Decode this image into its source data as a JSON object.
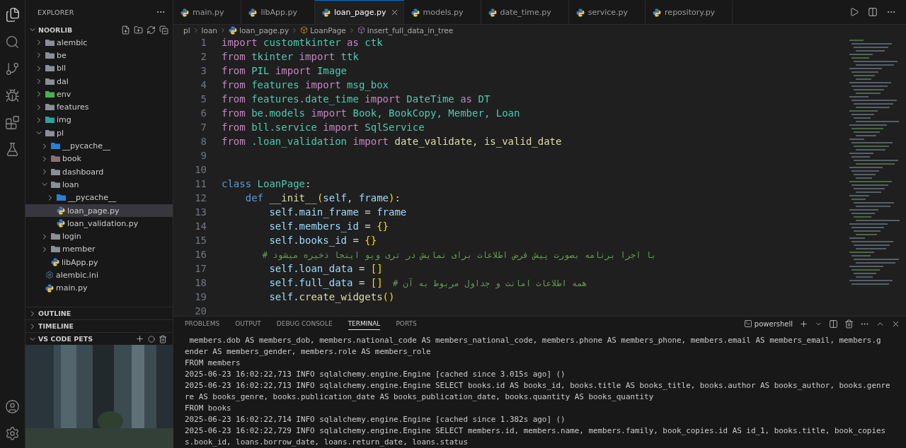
{
  "explorer": {
    "title": "EXPLORER",
    "project": {
      "name": "NOORLIB",
      "expanded": true
    },
    "tree": [
      {
        "label": "alembic",
        "kind": "folder",
        "expanded": false,
        "selected": false
      },
      {
        "label": "be",
        "kind": "folder",
        "expanded": false,
        "selected": false
      },
      {
        "label": "bll",
        "kind": "folder",
        "expanded": false,
        "selected": false
      },
      {
        "label": "dal",
        "kind": "folder",
        "expanded": false,
        "selected": false
      },
      {
        "label": "env",
        "kind": "env-folder",
        "expanded": false,
        "selected": false
      },
      {
        "label": "features",
        "kind": "folder",
        "expanded": false,
        "selected": false
      },
      {
        "label": "img",
        "kind": "image-folder",
        "expanded": false,
        "selected": false
      },
      {
        "label": "pl",
        "kind": "folder",
        "expanded": true,
        "selected": false,
        "children": [
          {
            "label": "__pycache__",
            "kind": "cache-folder",
            "expanded": false,
            "selected": false
          },
          {
            "label": "book",
            "kind": "book-folder",
            "expanded": false,
            "selected": false
          },
          {
            "label": "dashboard",
            "kind": "folder",
            "expanded": false,
            "selected": false
          },
          {
            "label": "loan",
            "kind": "folder",
            "expanded": true,
            "selected": false,
            "children": [
              {
                "label": "__pycache__",
                "kind": "cache-folder",
                "expanded": false,
                "selected": false
              },
              {
                "label": "loan_page.py",
                "kind": "python",
                "selected": true
              },
              {
                "label": "loan_validation.py",
                "kind": "python",
                "selected": false
              }
            ]
          },
          {
            "label": "login",
            "kind": "folder",
            "expanded": false,
            "selected": false
          },
          {
            "label": "member",
            "kind": "folder",
            "expanded": false,
            "selected": false
          },
          {
            "label": "libApp.py",
            "kind": "python",
            "selected": false
          }
        ]
      },
      {
        "label": "alembic.ini",
        "kind": "config",
        "selected": false
      },
      {
        "label": "main.py",
        "kind": "python",
        "selected": false
      }
    ]
  },
  "sections": [
    {
      "label": "OUTLINE",
      "expanded": false
    },
    {
      "label": "TIMELINE",
      "expanded": false
    },
    {
      "label": "VS CODE PETS",
      "expanded": true
    }
  ],
  "tabs": [
    {
      "label": "main.py",
      "selected": false
    },
    {
      "label": "libApp.py",
      "selected": false
    },
    {
      "label": "loan_page.py",
      "selected": true
    },
    {
      "label": "models.py",
      "selected": false
    },
    {
      "label": "date_time.py",
      "selected": false
    },
    {
      "label": "service.py",
      "selected": false
    },
    {
      "label": "repository.py",
      "selected": false
    }
  ],
  "breadcrumbs": [
    {
      "label": "pl",
      "kind": "folder"
    },
    {
      "label": "loan",
      "kind": "folder"
    },
    {
      "label": "loan_page.py",
      "kind": "file"
    },
    {
      "label": "LoanPage",
      "kind": "class"
    },
    {
      "label": "insert_full_data_in_tree",
      "kind": "method"
    }
  ],
  "code": [
    {
      "number": "1",
      "tokens": [
        {
          "text": "import ",
          "kind": "keyword"
        },
        {
          "text": "customtkinter ",
          "kind": "type"
        },
        {
          "text": "as ",
          "kind": "keyword"
        },
        {
          "text": "ctk",
          "kind": "type"
        }
      ]
    },
    {
      "number": "2",
      "tokens": [
        {
          "text": "from ",
          "kind": "keyword"
        },
        {
          "text": "tkinter ",
          "kind": "type"
        },
        {
          "text": "import ",
          "kind": "keyword"
        },
        {
          "text": "ttk",
          "kind": "type"
        }
      ]
    },
    {
      "number": "3",
      "tokens": [
        {
          "text": "from ",
          "kind": "keyword"
        },
        {
          "text": "PIL ",
          "kind": "type"
        },
        {
          "text": "import ",
          "kind": "keyword"
        },
        {
          "text": "Image",
          "kind": "type"
        }
      ]
    },
    {
      "number": "4",
      "tokens": [
        {
          "text": "from ",
          "kind": "keyword"
        },
        {
          "text": "features ",
          "kind": "type"
        },
        {
          "text": "import ",
          "kind": "keyword"
        },
        {
          "text": "msg_box",
          "kind": "type"
        }
      ]
    },
    {
      "number": "5",
      "tokens": [
        {
          "text": "from ",
          "kind": "keyword"
        },
        {
          "text": "features.date_time ",
          "kind": "type"
        },
        {
          "text": "import ",
          "kind": "keyword"
        },
        {
          "text": "DateTime ",
          "kind": "type"
        },
        {
          "text": "as ",
          "kind": "keyword"
        },
        {
          "text": "DT",
          "kind": "type"
        }
      ]
    },
    {
      "number": "6",
      "tokens": [
        {
          "text": "from ",
          "kind": "keyword"
        },
        {
          "text": "be.models ",
          "kind": "type"
        },
        {
          "text": "import ",
          "kind": "keyword"
        },
        {
          "text": "Book, BookCopy, Member, Loan",
          "kind": "type"
        }
      ]
    },
    {
      "number": "7",
      "tokens": [
        {
          "text": "from ",
          "kind": "keyword"
        },
        {
          "text": "bll.service ",
          "kind": "type"
        },
        {
          "text": "import ",
          "kind": "keyword"
        },
        {
          "text": "SqlService",
          "kind": "type"
        }
      ]
    },
    {
      "number": "8",
      "tokens": [
        {
          "text": "from ",
          "kind": "keyword"
        },
        {
          "text": ".loan_validation ",
          "kind": "type"
        },
        {
          "text": "import ",
          "kind": "keyword"
        },
        {
          "text": "date_validate, is_valid_date",
          "kind": "function"
        }
      ]
    },
    {
      "number": "9"
    },
    {
      "number": "10"
    },
    {
      "number": "11",
      "tokens": [
        {
          "text": "class ",
          "kind": "storage"
        },
        {
          "text": "LoanPage",
          "kind": "type"
        },
        {
          "text": ":",
          "kind": "plain"
        }
      ]
    },
    {
      "number": "12",
      "tokens": [
        {
          "text": "    def ",
          "kind": "storage"
        },
        {
          "text": "__init__",
          "kind": "function"
        },
        {
          "text": "(",
          "kind": "bracket"
        },
        {
          "text": "self",
          "kind": "variable"
        },
        {
          "text": ", ",
          "kind": "plain"
        },
        {
          "text": "frame",
          "kind": "variable"
        },
        {
          "text": ")",
          "kind": "bracket"
        },
        {
          "text": ":",
          "kind": "plain"
        }
      ]
    },
    {
      "number": "13",
      "tokens": [
        {
          "text": "        self.main_frame ",
          "kind": "variable"
        },
        {
          "text": "= ",
          "kind": "plain"
        },
        {
          "text": "frame",
          "kind": "variable"
        }
      ]
    },
    {
      "number": "14",
      "tokens": [
        {
          "text": "        self.members_id ",
          "kind": "variable"
        },
        {
          "text": "= ",
          "kind": "plain"
        },
        {
          "text": "{}",
          "kind": "bracket"
        }
      ]
    },
    {
      "number": "15",
      "tokens": [
        {
          "text": "        self.books_id ",
          "kind": "variable"
        },
        {
          "text": "= ",
          "kind": "plain"
        },
        {
          "text": "{}",
          "kind": "bracket"
        }
      ]
    },
    {
      "number": "16",
      "tokens": [
        {
          "text": "        # با اجرا برنامه بصورت پیش فرض اطلاعات برای نمایش در تری ویو اینجا ذخیره میشود",
          "kind": "comment"
        }
      ]
    },
    {
      "number": "17",
      "tokens": [
        {
          "text": "        self.loan_data ",
          "kind": "variable"
        },
        {
          "text": "= ",
          "kind": "plain"
        },
        {
          "text": "[]",
          "kind": "bracket"
        }
      ]
    },
    {
      "number": "18",
      "tokens": [
        {
          "text": "        self.full_data ",
          "kind": "variable"
        },
        {
          "text": "= ",
          "kind": "plain"
        },
        {
          "text": "[]",
          "kind": "bracket"
        },
        {
          "text": "  # همه اطلاعات امانت و جداول مربوط به آن",
          "kind": "comment"
        }
      ]
    },
    {
      "number": "19",
      "tokens": [
        {
          "text": "        self.",
          "kind": "variable"
        },
        {
          "text": "create_widgets",
          "kind": "function"
        },
        {
          "text": "()",
          "kind": "bracket"
        }
      ]
    },
    {
      "number": "20"
    }
  ],
  "panel": {
    "tabs": [
      {
        "label": "PROBLEMS",
        "selected": false
      },
      {
        "label": "OUTPUT",
        "selected": false
      },
      {
        "label": "DEBUG CONSOLE",
        "selected": false
      },
      {
        "label": "TERMINAL",
        "selected": true
      },
      {
        "label": "PORTS",
        "selected": false
      }
    ],
    "shell": "powershell",
    "terminal": [
      " members.dob AS members_dob, members.national_code AS members_national_code, members.phone AS members_phone, members.email AS members_email, members.g",
      "ender AS members_gender, members.role AS members_role",
      "FROM members",
      "2025-06-23 16:02:22,713 INFO sqlalchemy.engine.Engine [cached since 3.015s ago] ()",
      "2025-06-23 16:02:22,713 INFO sqlalchemy.engine.Engine SELECT books.id AS books_id, books.title AS books_title, books.author AS books_author, books.genre",
      "re AS books_genre, books.publication_date AS books_publication_date, books.quantity AS books_quantity",
      "FROM books",
      "2025-06-23 16:02:22,714 INFO sqlalchemy.engine.Engine [cached since 1.382s ago] ()",
      "2025-06-23 16:02:22,729 INFO sqlalchemy.engine.Engine SELECT members.id, members.name, members.family, book_copies.id AS id_1, books.title, book_copies",
      "s.book_id, loans.borrow_date, loans.return_date, loans.status"
    ]
  }
}
